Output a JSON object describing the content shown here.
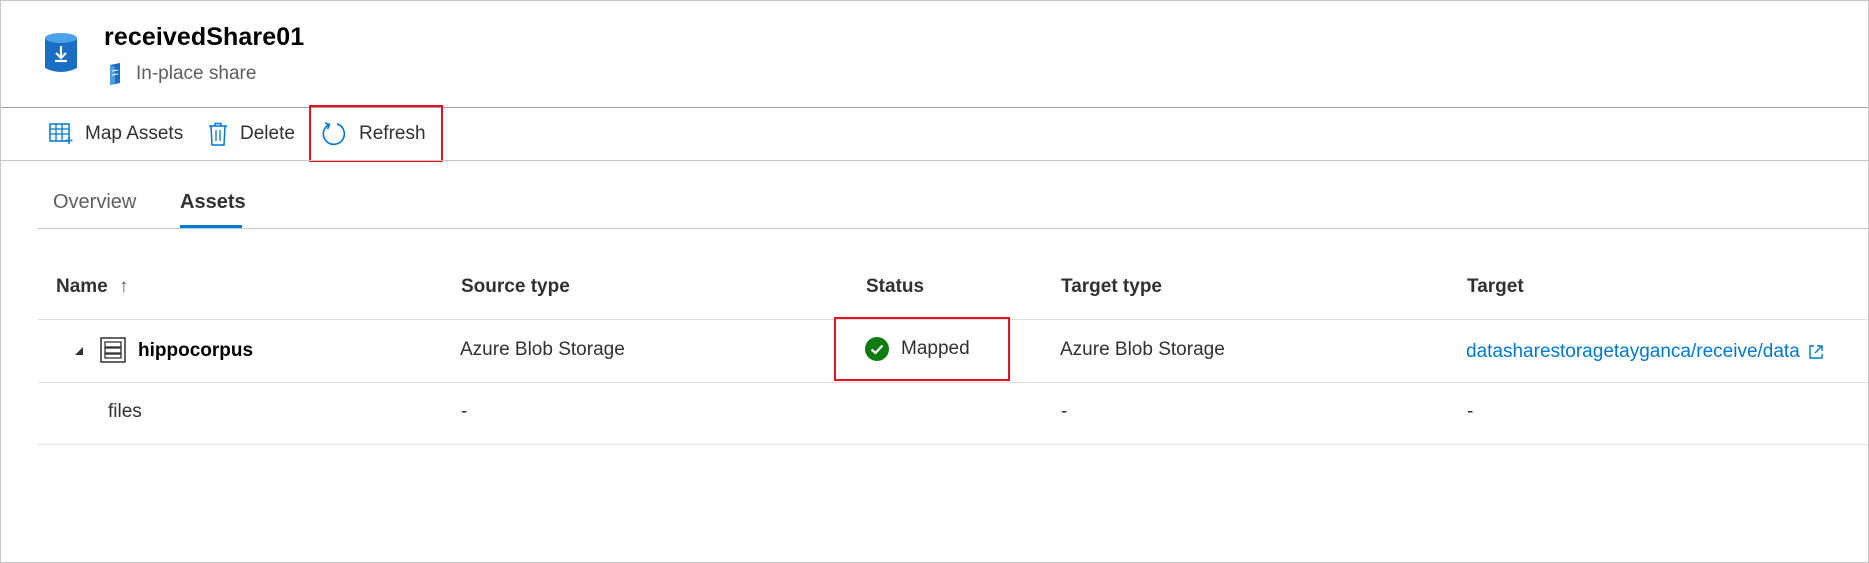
{
  "header": {
    "title": "receivedShare01",
    "subtitle": "In-place share",
    "icon": "share-storage-icon"
  },
  "toolbar": {
    "map_assets_label": "Map Assets",
    "delete_label": "Delete",
    "refresh_label": "Refresh"
  },
  "tabs": [
    {
      "label": "Overview",
      "active": false
    },
    {
      "label": "Assets",
      "active": true
    }
  ],
  "table": {
    "columns": [
      {
        "label": "Name",
        "sort": "↑"
      },
      {
        "label": "Source type"
      },
      {
        "label": "Status"
      },
      {
        "label": "Target type"
      },
      {
        "label": "Target"
      }
    ],
    "rows": [
      {
        "name": "hippocorpus",
        "expanded": true,
        "source_type": "Azure Blob Storage",
        "status": "Mapped",
        "target_type": "Azure Blob Storage",
        "target": "datasharestoragetayganca/receive/data"
      },
      {
        "name": "files",
        "source_type": "-",
        "status": "",
        "target_type": "-",
        "target": "-"
      }
    ]
  },
  "colors": {
    "accent": "#0078d4",
    "highlight": "#e81123",
    "success": "#107c10"
  }
}
